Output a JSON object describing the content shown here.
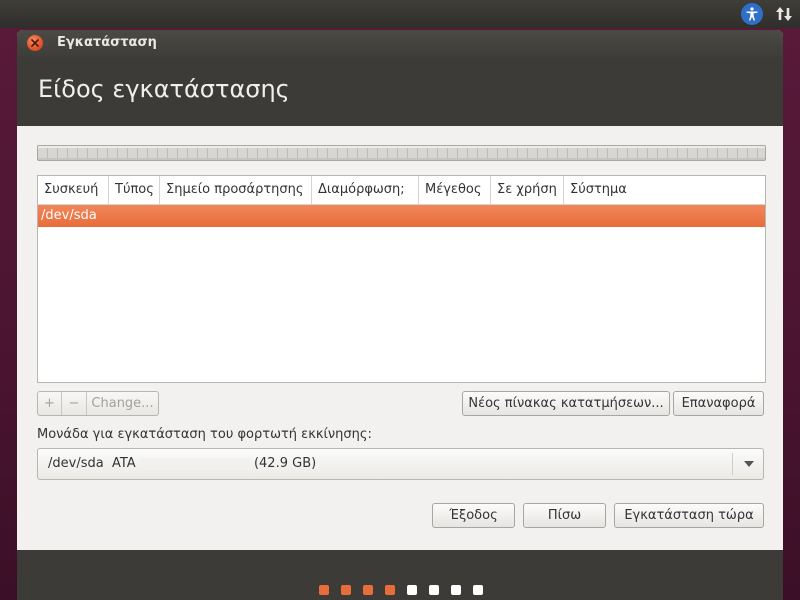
{
  "window": {
    "title": "Εγκατάσταση",
    "page_title": "Είδος εγκατάστασης"
  },
  "table": {
    "columns": [
      "Συσκευή",
      "Τύπος",
      "Σημείο προσάρτησης",
      "Διαμόρφωση;",
      "Μέγεθος",
      "Σε χρήση",
      "Σύστημα"
    ],
    "rows": [
      {
        "device": "/dev/sda",
        "selected": true
      }
    ]
  },
  "toolbar": {
    "add_label": "+",
    "remove_label": "−",
    "change_label": "Change...",
    "new_table_label": "Νέος πίνακας κατατμήσεων...",
    "revert_label": "Επαναφορά"
  },
  "bootloader": {
    "label": "Μονάδα για εγκατάσταση του φορτωτή εκκίνησης:",
    "device": "/dev/sda",
    "vendor": "ATA",
    "size": "(42.9 GB)"
  },
  "actions": {
    "quit_label": "Έξοδος",
    "back_label": "Πίσω",
    "install_label": "Εγκατάσταση τώρα"
  },
  "progress": {
    "total_steps": 8,
    "completed_steps": 4,
    "active_color": "#e76d3a",
    "inactive_color": "#ffffff"
  },
  "colors": {
    "accent": "#e76d3a",
    "header_bg": "#3c3b37",
    "window_bg": "#f2f1f0"
  }
}
